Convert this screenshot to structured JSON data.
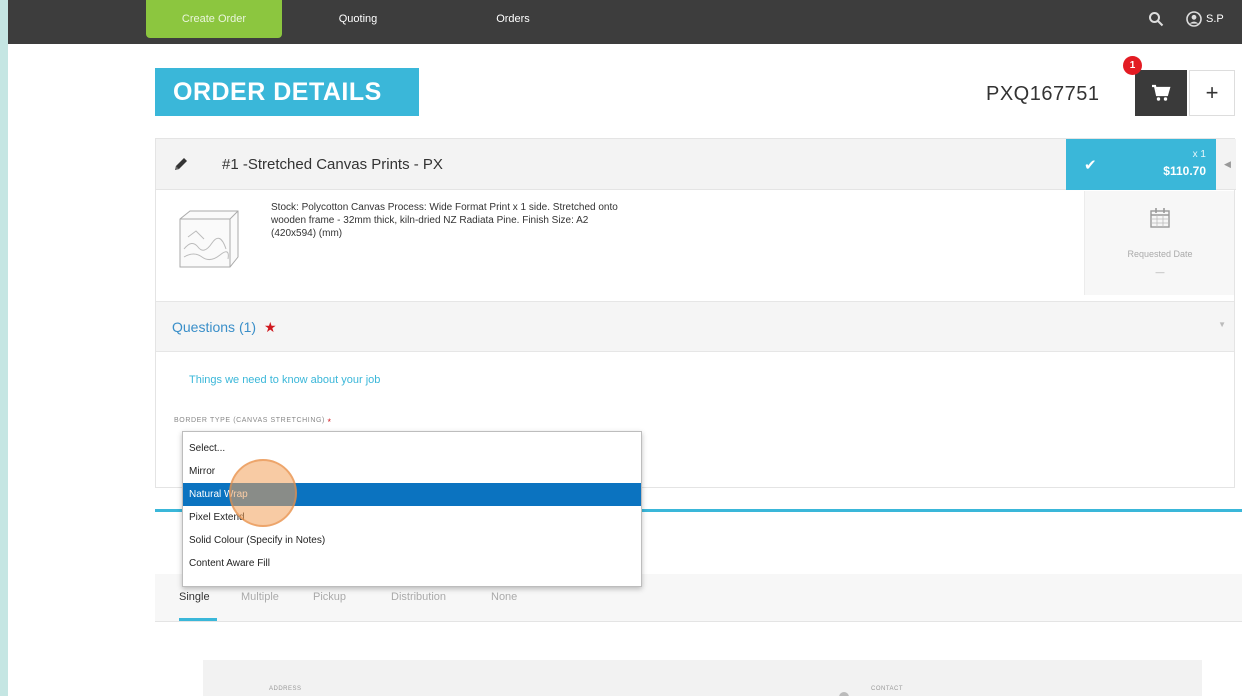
{
  "nav": {
    "create_order": "Create Order",
    "quoting": "Quoting",
    "orders": "Orders",
    "user_initials": "S.P"
  },
  "header": {
    "title": "ORDER DETAILS",
    "order_number": "PXQ167751",
    "cart_count": "1",
    "add_symbol": "+"
  },
  "item": {
    "title": "#1 -Stretched Canvas Prints - PX",
    "quantity": "x 1",
    "price": "$110.70",
    "description": "Stock: Polycotton Canvas Process: Wide Format Print x 1 side. Stretched onto wooden frame - 32mm thick, kiln-dried NZ Radiata Pine. Finish Size: A2 (420x594) (mm)",
    "requested_date_label": "Requested Date",
    "requested_date_value": "—"
  },
  "questions": {
    "label": "Questions",
    "count": "(1)",
    "required_mark": "★",
    "hint": "Things we need to know about your job",
    "field_label": "BORDER TYPE (CANVAS STRETCHING)",
    "field_required": "*",
    "options": [
      "Select...",
      "Mirror",
      "Natural Wrap",
      "Pixel Extend",
      "Solid Colour (Specify in Notes)",
      "Content Aware Fill"
    ],
    "highlighted_option": "Natural Wrap"
  },
  "delivery": {
    "tabs": [
      "Single",
      "Multiple",
      "Pickup",
      "Distribution",
      "None"
    ],
    "active_tab": "Single",
    "address_label": "ADDRESS",
    "contact_label": "CONTACT"
  },
  "colors": {
    "accent": "#3ab7d9",
    "nav_bg": "#3d3d3d",
    "create_green": "#8cc63f",
    "select_highlight": "#0b73c0",
    "badge_red": "#e31b23"
  }
}
